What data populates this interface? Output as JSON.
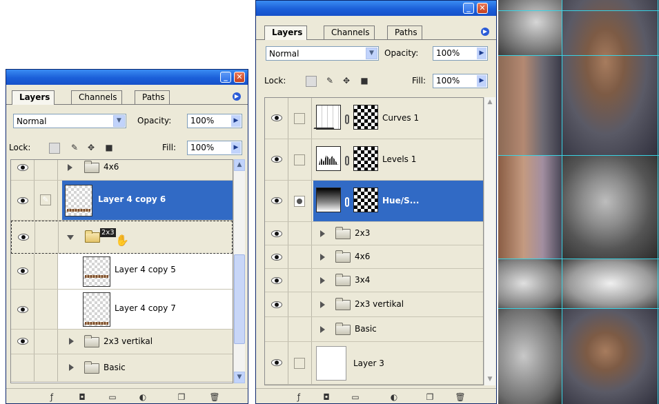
{
  "left_panel": {
    "tabs": [
      "Layers",
      "Channels",
      "Paths"
    ],
    "blend_mode": "Normal",
    "opacity_label": "Opacity:",
    "opacity_value": "100%",
    "lock_label": "Lock:",
    "fill_label": "Fill:",
    "fill_value": "100%",
    "layers": [
      {
        "name": "4x6",
        "type": "group"
      },
      {
        "name": "Layer 4 copy 6",
        "type": "layer",
        "selected": true
      },
      {
        "name": "",
        "type": "group-open",
        "dragging": true
      },
      {
        "name": "Layer 4 copy 5",
        "type": "layer"
      },
      {
        "name": "Layer 4 copy 7",
        "type": "layer"
      },
      {
        "name": "2x3 vertikal",
        "type": "group"
      },
      {
        "name": "Basic",
        "type": "group"
      }
    ],
    "drag_badge": "2x3"
  },
  "right_panel": {
    "tabs": [
      "Layers",
      "Channels",
      "Paths"
    ],
    "blend_mode": "Normal",
    "opacity_label": "Opacity:",
    "opacity_value": "100%",
    "lock_label": "Lock:",
    "fill_label": "Fill:",
    "fill_value": "100%",
    "layers": [
      {
        "name": "Curves 1",
        "type": "adjustment"
      },
      {
        "name": "Levels 1",
        "type": "adjustment"
      },
      {
        "name": "Hue/S...",
        "type": "adjustment",
        "selected": true
      },
      {
        "name": "2x3",
        "type": "group"
      },
      {
        "name": "4x6",
        "type": "group"
      },
      {
        "name": "3x4",
        "type": "group"
      },
      {
        "name": "2x3 vertikal",
        "type": "group"
      },
      {
        "name": "Basic",
        "type": "group"
      },
      {
        "name": "Layer 3",
        "type": "layer"
      }
    ]
  },
  "icons": {
    "eye": "eye-icon",
    "brush": "brush-icon",
    "folder": "folder-icon",
    "link": "chain-link-icon"
  },
  "colors": {
    "selection": "#316ac5",
    "titlebar": "#1b5fd9",
    "guides": "#39d5e6"
  }
}
